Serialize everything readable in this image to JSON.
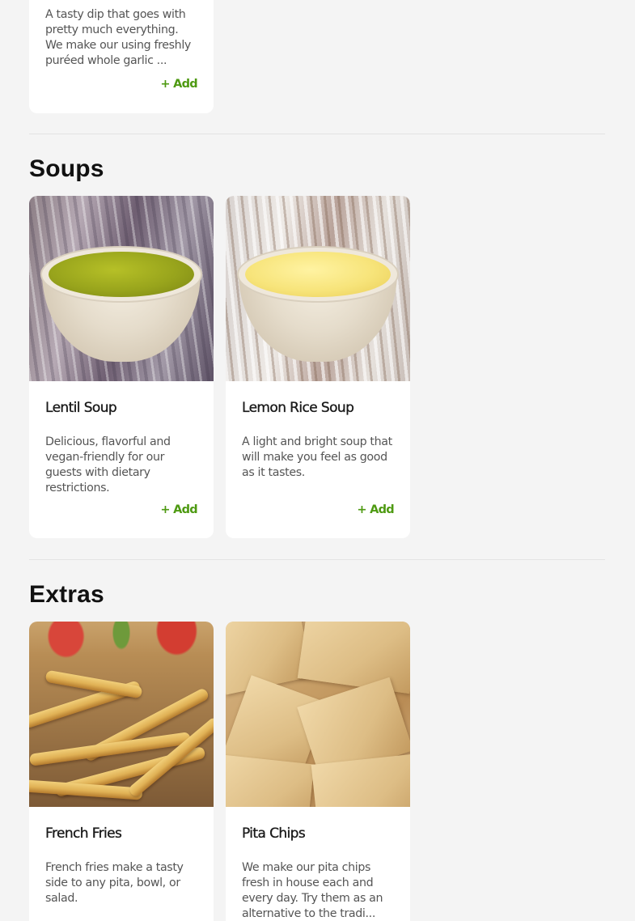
{
  "colors": {
    "page_background": "#f4f4f4",
    "card_background": "#ffffff",
    "add_accent": "#4e9a12"
  },
  "top_card": {
    "description": "A tasty dip that goes with pretty much everything. We make our using freshly puréed whole garlic ...",
    "add_label": "+ Add"
  },
  "sections": [
    {
      "title": "Soups",
      "items": [
        {
          "name": "Lentil Soup",
          "description": "Delicious, flavorful and vegan-friendly for our guests with dietary restrictions.",
          "add_label": "+ Add"
        },
        {
          "name": "Lemon Rice Soup",
          "description": "A light and bright soup that will make you feel as good as it tastes.",
          "add_label": "+ Add"
        }
      ]
    },
    {
      "title": "Extras",
      "items": [
        {
          "name": "French Fries",
          "description": "French fries make a tasty side to any pita, bowl, or salad."
        },
        {
          "name": "Pita Chips",
          "description": "We make our pita chips fresh in house each and every day. Try them as an alternative to the tradi..."
        }
      ]
    }
  ]
}
